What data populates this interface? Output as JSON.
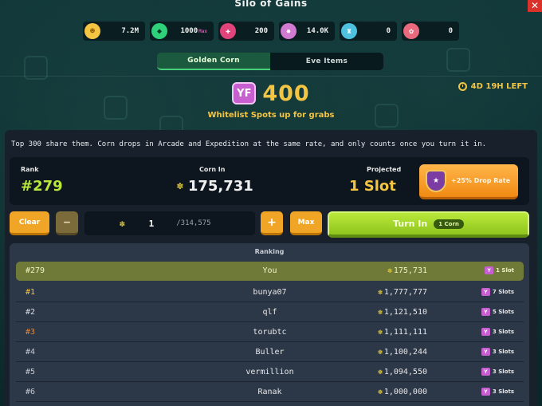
{
  "window": {
    "title": "Silo of Gains",
    "close_label": "✕"
  },
  "resources": [
    {
      "icon": "gold-coin-icon",
      "value": "7.2M",
      "suffix": "",
      "color": "#f4c542"
    },
    {
      "icon": "gem-icon",
      "value": "1000",
      "suffix": "Max",
      "color": "#2fd17a"
    },
    {
      "icon": "potion-plus-icon",
      "value": "200",
      "suffix": "",
      "color": "#e0447a"
    },
    {
      "icon": "star-badge-icon",
      "value": "14.0K",
      "suffix": "",
      "color": "#d17ad1"
    },
    {
      "icon": "trophy-icon",
      "value": "0",
      "suffix": "",
      "color": "#4ec0e0"
    },
    {
      "icon": "key-flower-icon",
      "value": "0",
      "suffix": "",
      "color": "#e86a7c"
    }
  ],
  "tabs": [
    {
      "label": "Golden Corn",
      "active": true
    },
    {
      "label": "Eve Items",
      "active": false
    }
  ],
  "hero": {
    "badge": "YF",
    "value": "400",
    "subtitle": "Whitelist Spots up for grabs"
  },
  "timer": {
    "label": "4D 19H LEFT"
  },
  "info_text": "Top 300 share them. Corn drops in Arcade and Expedition at the same rate, and only counts once you turn it in.",
  "stats": {
    "rank_label": "Rank",
    "rank_value": "#279",
    "corn_label": "Corn In",
    "corn_value": "175,731",
    "projected_label": "Projected",
    "projected_value": "1 Slot",
    "drop_rate_label": "+25% Drop Rate"
  },
  "controls": {
    "clear_label": "Clear",
    "minus_label": "−",
    "qty_value": "1",
    "qty_max": "/314,575",
    "plus_label": "+",
    "max_label": "Max",
    "turnin_label": "Turn In",
    "turnin_pill": "1 Corn"
  },
  "ranking": {
    "title": "Ranking",
    "self": {
      "rank": "#279",
      "name": "You",
      "corn": "175,731",
      "slots": "1 Slot"
    },
    "rows": [
      {
        "rank": "#1",
        "name": "bunya07",
        "corn": "1,777,777",
        "slots": "7 Slots",
        "rank_color": "#f4c542"
      },
      {
        "rank": "#2",
        "name": "qlf",
        "corn": "1,121,510",
        "slots": "5 Slots",
        "rank_color": "#d9dde3"
      },
      {
        "rank": "#3",
        "name": "torubtc",
        "corn": "1,111,111",
        "slots": "3 Slots",
        "rank_color": "#e08a3c"
      },
      {
        "rank": "#4",
        "name": "Buller",
        "corn": "1,100,244",
        "slots": "3 Slots",
        "rank_color": "#c5cad2"
      },
      {
        "rank": "#5",
        "name": "vermillion",
        "corn": "1,094,550",
        "slots": "3 Slots",
        "rank_color": "#c5cad2"
      },
      {
        "rank": "#6",
        "name": "Ranak",
        "corn": "1,000,000",
        "slots": "3 Slots",
        "rank_color": "#c5cad2"
      }
    ]
  }
}
